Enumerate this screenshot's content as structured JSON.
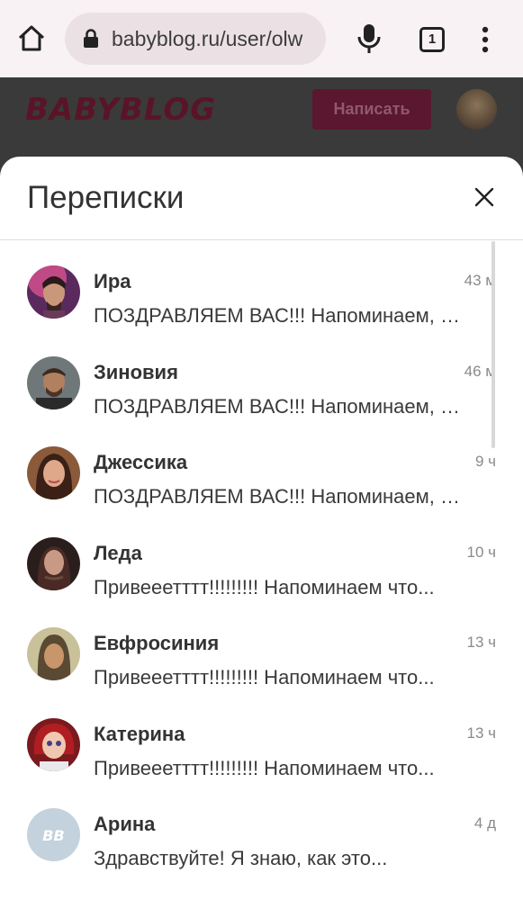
{
  "browser": {
    "url": "babyblog.ru/user/olw",
    "tab_count": "1"
  },
  "site": {
    "logo": "BABYBLOG",
    "write_button": "Написать"
  },
  "sheet": {
    "title": "Переписки"
  },
  "conversations": [
    {
      "name": "Ира",
      "time": "43 м",
      "preview": "ПОЗДРАВЛЯЕМ ВАС!!! Напоминаем, что"
    },
    {
      "name": "Зиновия",
      "time": "46 м",
      "preview": "ПОЗДРАВЛЯЕМ ВАС!!! Напоминаем, что"
    },
    {
      "name": "Джессика",
      "time": "9 ч",
      "preview": "ПОЗДРАВЛЯЕМ ВАС!!! Напоминаем, что"
    },
    {
      "name": "Леда",
      "time": "10 ч",
      "preview": "Привееетттт!!!!!!!!! Напоминаем что..."
    },
    {
      "name": "Евфросиния",
      "time": "13 ч",
      "preview": "Привееетттт!!!!!!!!! Напоминаем что..."
    },
    {
      "name": "Катерина",
      "time": "13 ч",
      "preview": "Привееетттт!!!!!!!!! Напоминаем что..."
    },
    {
      "name": "Арина",
      "time": "4 д",
      "preview": "Здравствуйте! Я знаю, как это..."
    }
  ],
  "placeholder_avatar_text": "BB",
  "colors": {
    "brand": "#5b1630",
    "chrome_bg": "#f8f2f5",
    "url_bar_bg": "#ebe1e5"
  }
}
